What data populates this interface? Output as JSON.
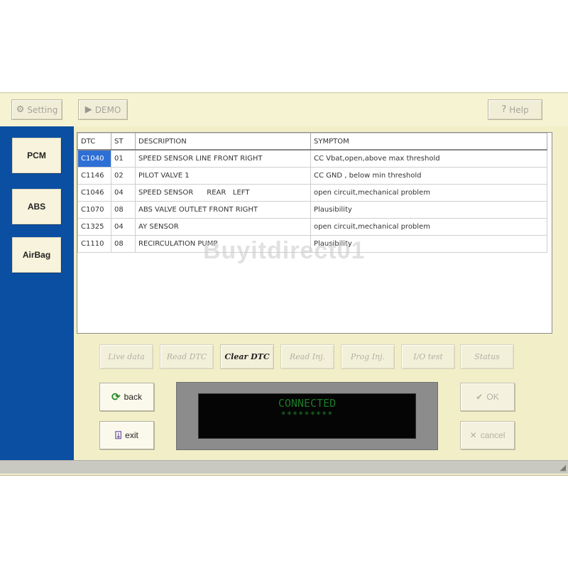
{
  "toolbar": {
    "setting_label": "Setting",
    "setting_icon": "gear-icon",
    "demo_label": "DEMO",
    "demo_icon": "play-icon",
    "help_label": "Help",
    "help_icon": "question-icon"
  },
  "sidebar": {
    "items": [
      {
        "label": "PCM"
      },
      {
        "label": "ABS"
      },
      {
        "label": "AirBag"
      }
    ]
  },
  "table": {
    "headers": [
      "DTC",
      "ST",
      "DESCRIPTION",
      "SYMPTOM"
    ],
    "rows": [
      {
        "dtc": "C1040",
        "st": "01",
        "description": "SPEED SENSOR LINE FRONT RIGHT",
        "symptom": "CC Vbat,open,above max threshold"
      },
      {
        "dtc": "C1146",
        "st": "02",
        "description": "PILOT VALVE 1",
        "symptom": "CC GND , below min threshold"
      },
      {
        "dtc": "C1046",
        "st": "04",
        "description": "SPEED SENSOR      REAR   LEFT",
        "symptom": "open circuit,mechanical problem"
      },
      {
        "dtc": "C1070",
        "st": "08",
        "description": "ABS VALVE OUTLET FRONT RIGHT",
        "symptom": "Plausibility"
      },
      {
        "dtc": "C1325",
        "st": "04",
        "description": "AY SENSOR",
        "symptom": "open circuit,mechanical problem"
      },
      {
        "dtc": "C1110",
        "st": "08",
        "description": "RECIRCULATION PUMP",
        "symptom": "Plausibility"
      }
    ],
    "selected_row": 0
  },
  "watermark": "Buyitdirect01",
  "functions": {
    "live_data": "Live data",
    "read_dtc": "Read DTC",
    "clear_dtc": "Clear DTC",
    "read_inj": "Read Inj.",
    "prog_inj": "Prog Inj.",
    "io_test": "I/O test",
    "status": "Status"
  },
  "actions": {
    "back_label": "back",
    "back_icon": "refresh-icon",
    "exit_label": "exit",
    "exit_icon": "exit-icon",
    "ok_label": "OK",
    "ok_icon": "check-icon",
    "cancel_label": "cancel",
    "cancel_icon": "cancel-icon"
  },
  "display": {
    "status_text": "CONNECTED",
    "progress_text": "*********",
    "text_color": "#1c7a28"
  },
  "colors": {
    "sidebar": "#0b4fa2",
    "background": "#f2efc8",
    "selection": "#2e6fd6"
  }
}
